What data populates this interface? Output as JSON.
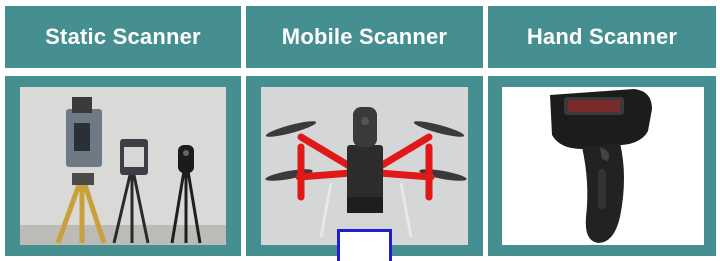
{
  "columns": [
    {
      "title": "Static Scanner",
      "image": "static-scanner-tripods-image"
    },
    {
      "title": "Mobile Scanner",
      "image": "mobile-scanner-drone-image"
    },
    {
      "title": "Hand Scanner",
      "image": "hand-barcode-scanner-image"
    }
  ],
  "colors": {
    "header_bg": "#458f91",
    "header_text": "#ffffff",
    "marker_border": "#1f1fd0"
  }
}
